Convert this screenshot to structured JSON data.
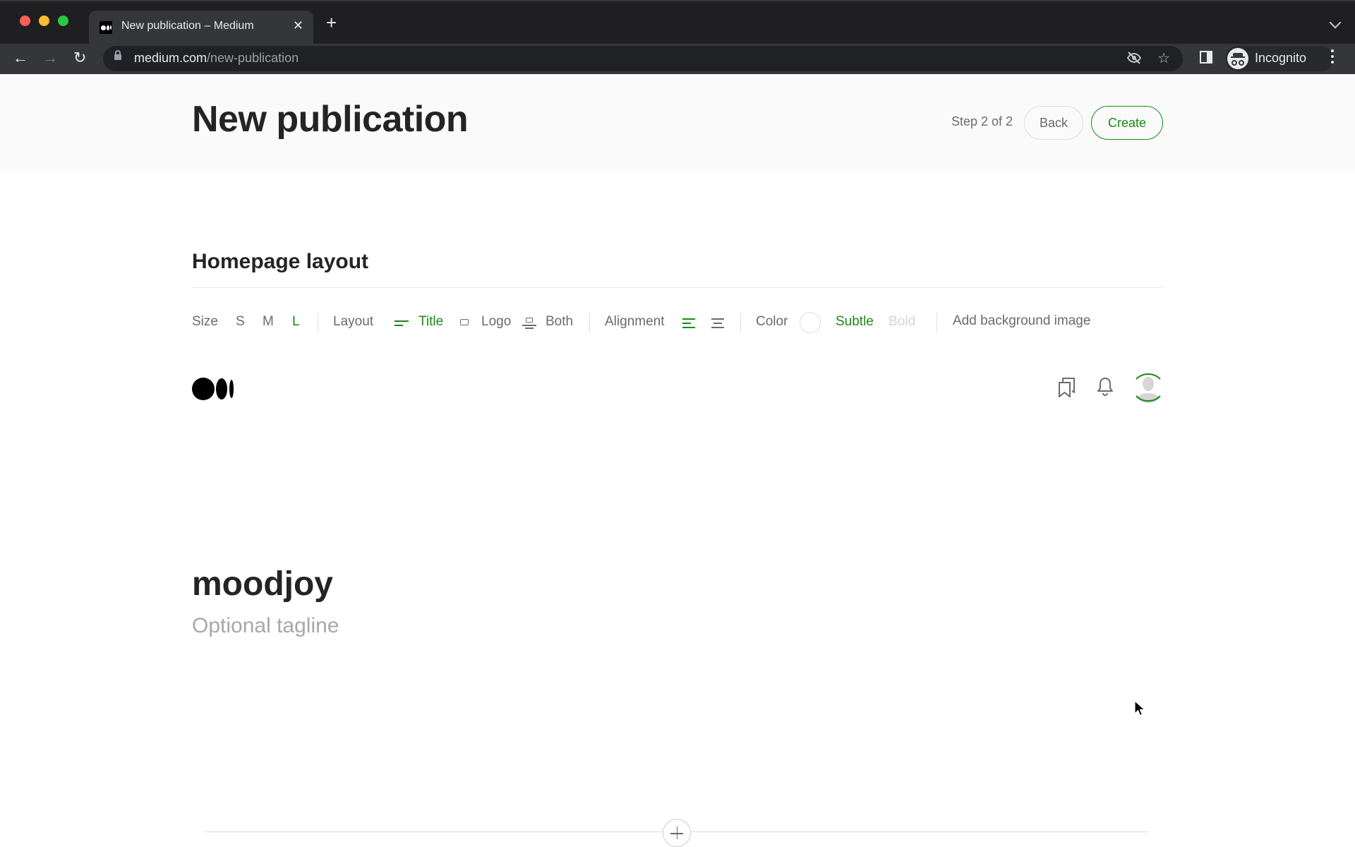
{
  "browser": {
    "tab": {
      "title": "New publication – Medium",
      "favicon": "medium-logo-icon"
    },
    "new_tab_label": "+",
    "url_host": "medium.com",
    "url_path": "/new-publication",
    "profile_label": "Incognito",
    "icons": {
      "back": "←",
      "forward": "→",
      "reload": "↻",
      "close": "✕",
      "eye_off": "eye-off-icon",
      "star": "☆"
    },
    "traffic_lights": {
      "close": "#fe5f57",
      "minimize": "#febc2e",
      "maximize": "#28c840"
    }
  },
  "header": {
    "title": "New publication",
    "step": "Step 2 of 2",
    "back_label": "Back",
    "create_label": "Create"
  },
  "section": {
    "title": "Homepage layout"
  },
  "controls": {
    "size": {
      "label": "Size",
      "options": [
        "S",
        "M",
        "L"
      ],
      "selected": "L"
    },
    "layout": {
      "label": "Layout",
      "options": [
        "Title",
        "Logo",
        "Both"
      ],
      "selected": "Title"
    },
    "alignment": {
      "label": "Alignment",
      "options": [
        "left",
        "center"
      ],
      "selected": "left"
    },
    "color": {
      "label": "Color",
      "swatch": "#ffffff",
      "options": [
        "Subtle",
        "Bold"
      ],
      "selected": "Subtle"
    },
    "background_label": "Add background image"
  },
  "preview": {
    "publication_name": "moodjoy",
    "tagline_placeholder": "Optional tagline"
  },
  "colors": {
    "accent": "#1a8917",
    "text": "#242424",
    "muted": "#6b6b6b",
    "disabled": "#d5d5d5",
    "header_bg": "#fafafa"
  }
}
